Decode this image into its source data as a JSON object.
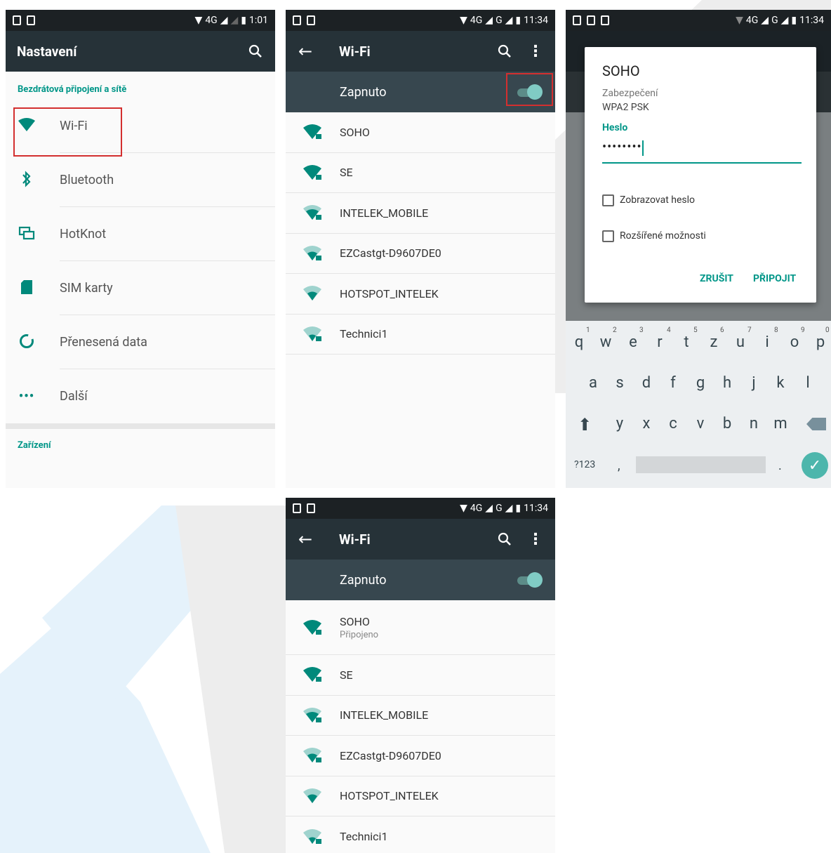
{
  "panel1": {
    "status": {
      "network": "4G",
      "time": "1:01"
    },
    "toolbar_title": "Nastavení",
    "section_wireless": "Bezdrátová připojení a sítě",
    "items": [
      {
        "label": "Wi-Fi",
        "icon": "wifi-icon"
      },
      {
        "label": "Bluetooth",
        "icon": "bluetooth-icon"
      },
      {
        "label": "HotKnot",
        "icon": "hotknot-icon"
      },
      {
        "label": "SIM karty",
        "icon": "sim-card-icon"
      },
      {
        "label": "Přenesená data",
        "icon": "data-usage-icon"
      },
      {
        "label": "Další",
        "icon": "more-icon"
      }
    ],
    "section_device": "Zařízení"
  },
  "panel2": {
    "status": {
      "network": "4G",
      "network2": "G",
      "time": "11:34"
    },
    "toolbar_title": "Wi-Fi",
    "switch_label": "Zapnuto",
    "networks": [
      {
        "ssid": "SOHO"
      },
      {
        "ssid": "SE"
      },
      {
        "ssid": "INTELEK_MOBILE"
      },
      {
        "ssid": "EZCastgt-D9607DE0"
      },
      {
        "ssid": "HOTSPOT_INTELEK"
      },
      {
        "ssid": "Technici1"
      }
    ]
  },
  "panel3": {
    "status": {
      "network": "4G",
      "network2": "G",
      "time": "11:34"
    },
    "dialog": {
      "title": "SOHO",
      "security_label": "Zabezpečení",
      "security_value": "WPA2 PSK",
      "password_label": "Heslo",
      "password_value": "••••••••",
      "show_password": "Zobrazovat heslo",
      "advanced": "Rozšířené možnosti",
      "cancel": "ZRUŠIT",
      "connect": "PŘIPOJIT"
    },
    "keyboard": {
      "row1": [
        "q",
        "w",
        "e",
        "r",
        "t",
        "z",
        "u",
        "i",
        "o",
        "p"
      ],
      "row1_nums": [
        "1",
        "2",
        "3",
        "4",
        "5",
        "6",
        "7",
        "8",
        "9",
        "0"
      ],
      "row2": [
        "a",
        "s",
        "d",
        "f",
        "g",
        "h",
        "j",
        "k",
        "l"
      ],
      "row3": [
        "y",
        "x",
        "c",
        "v",
        "b",
        "n",
        "m"
      ],
      "symbols_key": "?123",
      "comma": ",",
      "period": "."
    }
  },
  "panel4": {
    "status": {
      "network": "4G",
      "network2": "G",
      "time": "11:34"
    },
    "toolbar_title": "Wi-Fi",
    "switch_label": "Zapnuto",
    "networks": [
      {
        "ssid": "SOHO",
        "status": "Připojeno"
      },
      {
        "ssid": "SE"
      },
      {
        "ssid": "INTELEK_MOBILE"
      },
      {
        "ssid": "EZCastgt-D9607DE0"
      },
      {
        "ssid": "HOTSPOT_INTELEK"
      },
      {
        "ssid": "Technici1"
      }
    ]
  },
  "colors": {
    "accent": "#009688",
    "toolbar": "#263238",
    "statusbar": "#1c2124",
    "highlight": "#d32f2f"
  }
}
